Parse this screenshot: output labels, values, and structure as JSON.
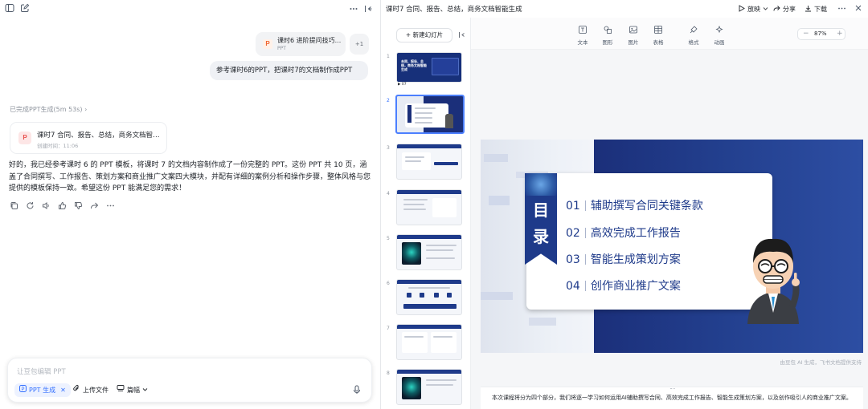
{
  "chat": {
    "attachment": {
      "title": "课时6 进阶提问技巧...",
      "subtitle": "PPT",
      "icon": "ppt-file-icon",
      "more_count": "+1"
    },
    "user_message": "参考课时6的PPT，把课时7的文档制作成PPT",
    "status": "已完成PPT生成(5m 53s) ›",
    "file_card": {
      "title": "课时7 合同、报告、总结，商务文档智能...",
      "created": "创建时间：11:06",
      "icon": "ppt-icon"
    },
    "ai_reply": "好的，我已经参考课时 6 的 PPT 模板，将课时 7 的文档内容制作成了一份完整的 PPT。这份 PPT 共 10 页，涵盖了合同撰写、工作报告、策划方案和商业推广文案四大模块，并配有详细的案例分析和操作步骤，整体风格与您提供的模板保持一致。希望这份 PPT 能满足您的需求！",
    "composer": {
      "placeholder": "让豆包编辑 PPT",
      "chip_label": "PPT 生成",
      "upload_label": "上传文件",
      "length_label": "篇幅"
    }
  },
  "editor": {
    "doc_title": "课时7 合同、报告、总结，商务文档智能生成",
    "header_buttons": {
      "play": "放映",
      "share": "分享",
      "download": "下载"
    },
    "new_slide": "+  新建幻灯片",
    "toolbar": [
      {
        "label": "文本",
        "icon": "text-icon"
      },
      {
        "label": "图形",
        "icon": "shape-icon"
      },
      {
        "label": "图片",
        "icon": "image-icon"
      },
      {
        "label": "表格",
        "icon": "table-icon"
      },
      {
        "label": "格式",
        "icon": "format-icon"
      },
      {
        "label": "动画",
        "icon": "animation-icon"
      }
    ],
    "zoom": "87%",
    "slide_numbers": [
      "1",
      "2",
      "3",
      "4",
      "5",
      "6",
      "7",
      "8"
    ],
    "slide1_title": "合同、报告、总结，商务文档智能生成",
    "slide1_num": "07",
    "slide": {
      "heading_chars": [
        "目",
        "录"
      ],
      "toc": [
        {
          "num": "01",
          "text": "辅助撰写合同关键条款"
        },
        {
          "num": "02",
          "text": "高效完成工作报告"
        },
        {
          "num": "03",
          "text": "智能生成策划方案"
        },
        {
          "num": "04",
          "text": "创作商业推广文案"
        }
      ]
    },
    "footer_note": "由豆包 AI 生成，飞书文档提供支持",
    "notes": "本次课程将分为四个部分，我们将逐一学习如何运用AI辅助撰写合同、高效完成工作报告、智能生成策划方案，以及创作吸引人的商业推广文案。",
    "colors": {
      "accent": "#3370ff",
      "slide_navy": "#1b2f7a",
      "slide_blue": "#2f4fa3"
    }
  }
}
